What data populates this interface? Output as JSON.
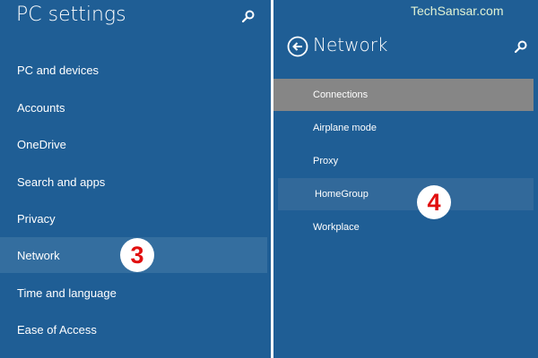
{
  "left": {
    "title": "PC settings",
    "search_icon": "search-icon",
    "items": [
      {
        "label": "PC and devices"
      },
      {
        "label": "Accounts"
      },
      {
        "label": "OneDrive"
      },
      {
        "label": "Search and apps"
      },
      {
        "label": "Privacy"
      },
      {
        "label": "Network",
        "selected": true
      },
      {
        "label": "Time and language"
      },
      {
        "label": "Ease of Access"
      }
    ]
  },
  "right": {
    "title": "Network",
    "back_icon": "back-arrow-icon",
    "search_icon": "search-icon",
    "items": [
      {
        "label": "Connections",
        "active": true
      },
      {
        "label": "Airplane mode"
      },
      {
        "label": "Proxy"
      },
      {
        "label": "HomeGroup",
        "hovered": true
      },
      {
        "label": "Workplace"
      }
    ]
  },
  "badges": [
    "3",
    "4"
  ],
  "watermark": "TechSansar.com",
  "colors": {
    "panel": "#1f5e95",
    "selected": "#346e9f",
    "active": "#868686",
    "badge_text": "#e10f0f"
  }
}
